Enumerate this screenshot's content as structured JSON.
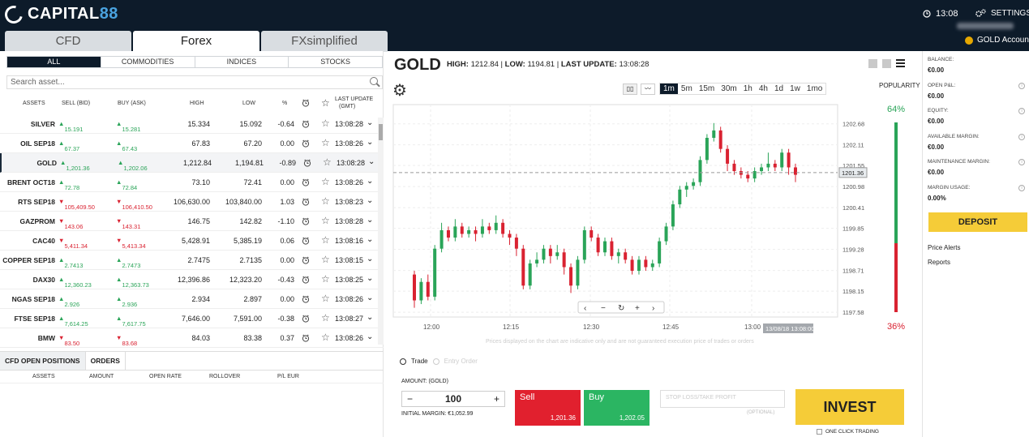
{
  "header": {
    "brand": "CAPITAL",
    "brand_num": "88",
    "time": "13:08",
    "settings": "SETTINGS",
    "account": "GOLD Account",
    "tabs": [
      "CFD",
      "Forex",
      "FXsimplified"
    ]
  },
  "categories": [
    "ALL",
    "COMMODITIES",
    "INDICES",
    "STOCKS"
  ],
  "search_placeholder": "Search asset...",
  "table_headers": {
    "assets": "ASSETS",
    "sell": "SELL (BID)",
    "buy": "BUY (ASK)",
    "high": "HIGH",
    "low": "LOW",
    "pct": "%",
    "update": "LAST UPDATE",
    "gmt": "(GMT)"
  },
  "assets": [
    {
      "name": "SILVER",
      "sell": "15.191",
      "buy": "15.281",
      "high": "15.334",
      "low": "15.092",
      "pct": "-0.64",
      "time": "13:08:28",
      "dir": "up"
    },
    {
      "name": "OIL SEP18",
      "sell": "67.37",
      "buy": "67.43",
      "high": "67.83",
      "low": "67.20",
      "pct": "0.00",
      "time": "13:08:26",
      "dir": "up"
    },
    {
      "name": "GOLD",
      "sell": "1,201.36",
      "buy": "1,202.06",
      "high": "1,212.84",
      "low": "1,194.81",
      "pct": "-0.89",
      "time": "13:08:28",
      "dir": "up"
    },
    {
      "name": "BRENT OCT18",
      "sell": "72.78",
      "buy": "72.84",
      "high": "73.10",
      "low": "72.41",
      "pct": "0.00",
      "time": "13:08:26",
      "dir": "up"
    },
    {
      "name": "RTS SEP18",
      "sell": "105,409.50",
      "buy": "106,410.50",
      "high": "106,630.00",
      "low": "103,840.00",
      "pct": "1.03",
      "time": "13:08:23",
      "dir": "down"
    },
    {
      "name": "GAZPROM",
      "sell": "143.06",
      "buy": "143.31",
      "high": "146.75",
      "low": "142.82",
      "pct": "-1.10",
      "time": "13:08:28",
      "dir": "down"
    },
    {
      "name": "CAC40",
      "sell": "5,411.34",
      "buy": "5,413.34",
      "high": "5,428.91",
      "low": "5,385.19",
      "pct": "0.06",
      "time": "13:08:16",
      "dir": "down"
    },
    {
      "name": "COPPER SEP18",
      "sell": "2.7413",
      "buy": "2.7473",
      "high": "2.7475",
      "low": "2.7135",
      "pct": "0.00",
      "time": "13:08:15",
      "dir": "up"
    },
    {
      "name": "DAX30",
      "sell": "12,360.23",
      "buy": "12,363.73",
      "high": "12,396.86",
      "low": "12,323.20",
      "pct": "-0.43",
      "time": "13:08:25",
      "dir": "up"
    },
    {
      "name": "NGAS SEP18",
      "sell": "2.926",
      "buy": "2.936",
      "high": "2.934",
      "low": "2.897",
      "pct": "0.00",
      "time": "13:08:26",
      "dir": "up"
    },
    {
      "name": "FTSE SEP18",
      "sell": "7,614.25",
      "buy": "7,617.75",
      "high": "7,646.00",
      "low": "7,591.00",
      "pct": "-0.38",
      "time": "13:08:27",
      "dir": "up"
    },
    {
      "name": "BMW",
      "sell": "83.50",
      "buy": "83.68",
      "high": "84.03",
      "low": "83.38",
      "pct": "0.37",
      "time": "13:08:26",
      "dir": "down"
    }
  ],
  "positions": {
    "tabs": [
      "CFD OPEN POSITIONS",
      "ORDERS"
    ],
    "headers": [
      "ASSETS",
      "AMOUNT",
      "OPEN RATE",
      "ROLLOVER",
      "P/L EUR"
    ]
  },
  "chart_panel": {
    "title": "GOLD",
    "high_label": "HIGH:",
    "high": "1212.84",
    "low_label": "LOW:",
    "low": "1194.81",
    "update_label": "LAST UPDATE:",
    "update": "13:08:28",
    "timeframes": [
      "1m",
      "5m",
      "15m",
      "30m",
      "1h",
      "4h",
      "1d",
      "1w",
      "1mo"
    ],
    "popularity": "POPULARITY",
    "pop_buy": "64%",
    "pop_sell": "36%",
    "note": "Prices displayed on the chart are indicative only and are not guaranteed execution price of trades or orders",
    "crosshair_label": "13/08/18 13:08:00",
    "current_price_label": "1201.36"
  },
  "trade": {
    "mode_trade": "Trade",
    "mode_order": "Entry Order",
    "amount_label": "AMOUNT: (GOLD)",
    "amount": "100",
    "minus": "−",
    "plus": "+",
    "margin": "INITIAL MARGIN: €1,052.99",
    "sell_label": "Sell",
    "sell_price": "1,201.36",
    "buy_label": "Buy",
    "buy_price": "1,202.05",
    "stoploss": "STOP LOSS/TAKE PROFIT",
    "optional": "(OPTIONAL)",
    "invest": "INVEST",
    "one_click": "ONE CLICK TRADING"
  },
  "account": {
    "items": [
      {
        "label": "BALANCE:",
        "value": "€0.00"
      },
      {
        "label": "OPEN P&L:",
        "value": "€0.00"
      },
      {
        "label": "EQUITY:",
        "value": "€0.00"
      },
      {
        "label": "AVAILABLE MARGIN:",
        "value": "€0.00"
      },
      {
        "label": "MAINTENANCE MARGIN:",
        "value": "€0.00"
      },
      {
        "label": "MARGIN USAGE:",
        "value": "0.00%"
      }
    ],
    "deposit": "DEPOSIT",
    "price_alerts": "Price Alerts",
    "reports": "Reports"
  },
  "chart_data": {
    "type": "candlestick",
    "y_ticks": [
      1202.68,
      1202.11,
      1201.55,
      1200.98,
      1200.41,
      1199.85,
      1199.28,
      1198.71,
      1198.15,
      1197.58
    ],
    "x_ticks": [
      "12:00",
      "12:15",
      "12:30",
      "12:45",
      "13:00"
    ],
    "ylim": [
      1197.45,
      1203.2
    ],
    "current_price": 1201.36,
    "candles": [
      [
        1198.6,
        1197.9,
        1198.7,
        1197.7
      ],
      [
        1197.9,
        1198.4,
        1198.5,
        1197.8
      ],
      [
        1198.4,
        1198.0,
        1198.6,
        1197.9
      ],
      [
        1198.0,
        1199.3,
        1199.4,
        1197.9
      ],
      [
        1199.3,
        1199.8,
        1200.0,
        1199.2
      ],
      [
        1199.8,
        1199.6,
        1199.9,
        1199.5
      ],
      [
        1199.6,
        1199.9,
        1200.1,
        1199.5
      ],
      [
        1199.9,
        1199.7,
        1200.0,
        1199.6
      ],
      [
        1199.7,
        1199.8,
        1199.9,
        1199.6
      ],
      [
        1199.8,
        1199.7,
        1199.9,
        1199.5
      ],
      [
        1199.7,
        1199.9,
        1200.1,
        1199.6
      ],
      [
        1199.9,
        1199.8,
        1200.0,
        1199.7
      ],
      [
        1199.8,
        1200.0,
        1200.2,
        1199.7
      ],
      [
        1200.0,
        1199.7,
        1200.1,
        1199.6
      ],
      [
        1199.7,
        1199.6,
        1199.8,
        1199.4
      ],
      [
        1199.6,
        1199.3,
        1199.7,
        1199.1
      ],
      [
        1199.3,
        1198.3,
        1199.4,
        1198.2
      ],
      [
        1198.3,
        1198.9,
        1199.0,
        1198.2
      ],
      [
        1198.9,
        1199.0,
        1199.2,
        1198.8
      ],
      [
        1199.0,
        1199.3,
        1199.4,
        1198.9
      ],
      [
        1199.3,
        1199.1,
        1199.4,
        1198.9
      ],
      [
        1199.1,
        1199.2,
        1199.4,
        1199.0
      ],
      [
        1199.2,
        1198.8,
        1199.3,
        1198.6
      ],
      [
        1198.8,
        1198.3,
        1198.9,
        1198.1
      ],
      [
        1198.3,
        1199.0,
        1199.1,
        1198.2
      ],
      [
        1199.0,
        1199.8,
        1199.9,
        1198.9
      ],
      [
        1199.8,
        1199.6,
        1199.9,
        1199.5
      ],
      [
        1199.6,
        1199.2,
        1199.7,
        1199.1
      ],
      [
        1199.2,
        1199.5,
        1199.6,
        1199.1
      ],
      [
        1199.5,
        1199.1,
        1199.6,
        1199.0
      ],
      [
        1199.1,
        1199.2,
        1199.3,
        1198.9
      ],
      [
        1199.2,
        1199.0,
        1199.3,
        1198.9
      ],
      [
        1199.0,
        1198.7,
        1199.1,
        1198.6
      ],
      [
        1198.7,
        1199.0,
        1199.1,
        1198.6
      ],
      [
        1199.0,
        1198.8,
        1199.1,
        1198.7
      ],
      [
        1198.8,
        1198.9,
        1199.0,
        1198.7
      ],
      [
        1198.9,
        1199.5,
        1199.6,
        1198.8
      ],
      [
        1199.5,
        1199.9,
        1200.0,
        1199.4
      ],
      [
        1199.9,
        1200.5,
        1200.6,
        1199.8
      ],
      [
        1200.5,
        1200.9,
        1201.0,
        1200.4
      ],
      [
        1200.9,
        1201.0,
        1201.1,
        1200.7
      ],
      [
        1201.0,
        1201.1,
        1201.2,
        1200.9
      ],
      [
        1201.1,
        1201.7,
        1201.8,
        1201.0
      ],
      [
        1201.7,
        1202.3,
        1202.4,
        1201.6
      ],
      [
        1202.3,
        1202.5,
        1202.7,
        1202.2
      ],
      [
        1202.5,
        1202.0,
        1202.6,
        1201.9
      ],
      [
        1202.0,
        1201.6,
        1202.1,
        1201.4
      ],
      [
        1201.6,
        1201.4,
        1201.7,
        1201.3
      ],
      [
        1201.4,
        1201.3,
        1201.5,
        1201.2
      ],
      [
        1201.3,
        1201.2,
        1201.4,
        1201.1
      ],
      [
        1201.2,
        1201.4,
        1201.5,
        1201.1
      ],
      [
        1201.4,
        1201.5,
        1201.6,
        1201.3
      ],
      [
        1201.5,
        1201.6,
        1201.9,
        1201.4
      ],
      [
        1201.6,
        1201.5,
        1201.7,
        1201.4
      ],
      [
        1201.5,
        1201.9,
        1202.0,
        1201.4
      ],
      [
        1201.9,
        1201.5,
        1202.0,
        1201.3
      ],
      [
        1201.5,
        1201.3,
        1201.6,
        1201.1
      ]
    ]
  }
}
